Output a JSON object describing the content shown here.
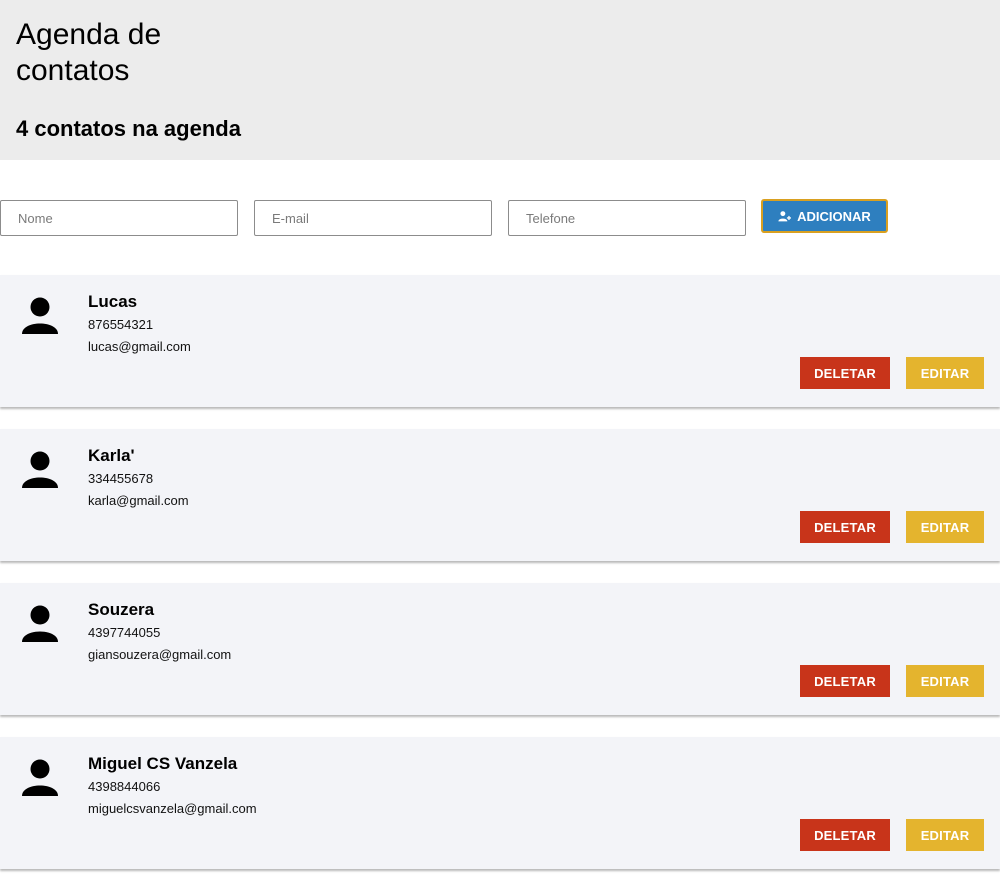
{
  "header": {
    "title": "Agenda de contatos",
    "count_text": "4 contatos na agenda"
  },
  "form": {
    "name_placeholder": "Nome",
    "email_placeholder": "E-mail",
    "phone_placeholder": "Telefone",
    "add_label": "ADICIONAR",
    "add_icon": "user-add-icon"
  },
  "contacts": [
    {
      "name": "Lucas",
      "phone": "876554321",
      "email": "lucas@gmail.com",
      "delete_label": "DELETAR",
      "edit_label": "EDITAR"
    },
    {
      "name": "Karla'",
      "phone": "334455678",
      "email": "karla@gmail.com",
      "delete_label": "DELETAR",
      "edit_label": "EDITAR"
    },
    {
      "name": "Souzera",
      "phone": "4397744055",
      "email": "giansouzera@gmail.com",
      "delete_label": "DELETAR",
      "edit_label": "EDITAR"
    },
    {
      "name": "Miguel CS Vanzela",
      "phone": "4398844066",
      "email": "miguelcsvanzela@gmail.com",
      "delete_label": "DELETAR",
      "edit_label": "EDITAR"
    }
  ],
  "colors": {
    "header_bg": "#ececec",
    "card_bg": "#f3f4f8",
    "add_button": "#2e7fbf",
    "add_button_border": "#d9a020",
    "delete_button": "#c8341a",
    "edit_button": "#e4b42e"
  }
}
